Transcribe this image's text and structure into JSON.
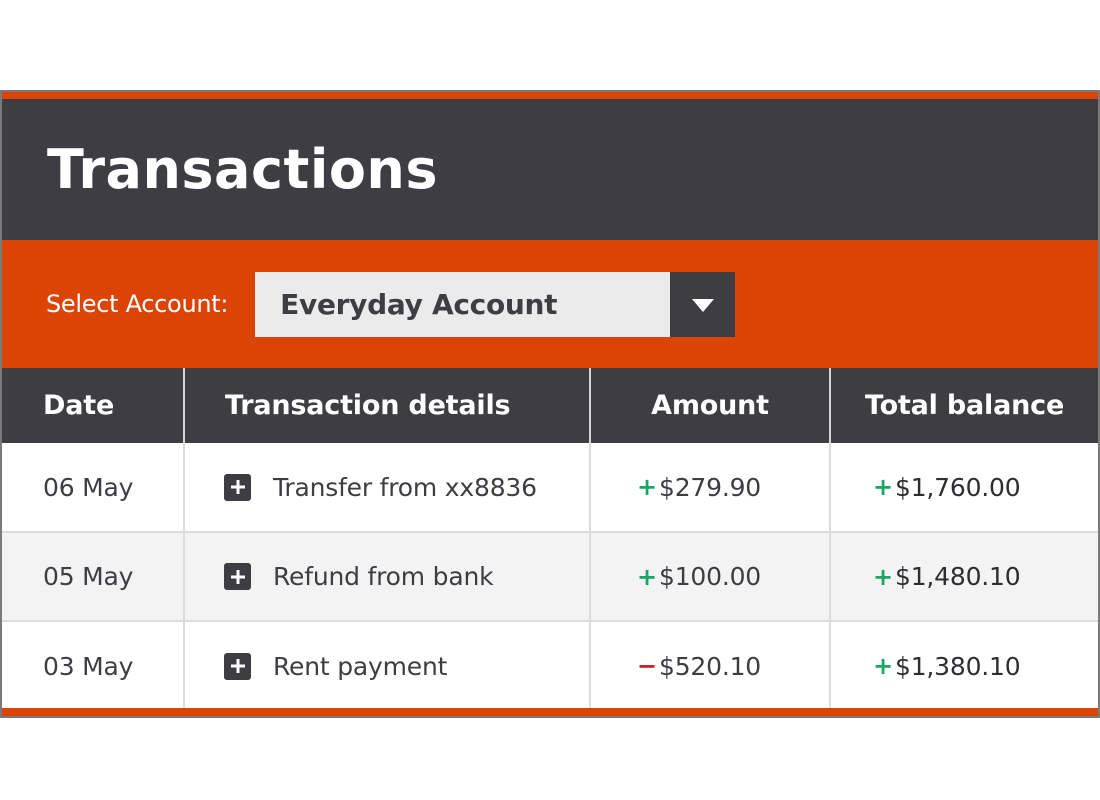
{
  "header": {
    "title": "Transactions"
  },
  "account_selector": {
    "label": "Select Account:",
    "selected": "Everyday Account",
    "arrow_icon": "caret-down-icon"
  },
  "table": {
    "columns": [
      "Date",
      "Transaction details",
      "Amount",
      "Total balance"
    ],
    "rows": [
      {
        "date": "06 May",
        "details": "Transfer from xx8836",
        "expand_icon": "plus-icon",
        "amount_sign": "+",
        "amount_type": "credit",
        "amount": "$279.90",
        "balance_sign": "+",
        "balance": "$1,760.00"
      },
      {
        "date": "05 May",
        "details": "Refund from bank",
        "expand_icon": "plus-icon",
        "amount_sign": "+",
        "amount_type": "credit",
        "amount": "$100.00",
        "balance_sign": "+",
        "balance": "$1,480.10"
      },
      {
        "date": "03 May",
        "details": "Rent payment",
        "expand_icon": "plus-icon",
        "amount_sign": "−",
        "amount_type": "debit",
        "amount": "$520.10",
        "balance_sign": "+",
        "balance": "$1,380.10"
      }
    ]
  },
  "colors": {
    "accent_orange": "#db4405",
    "dark": "#3e3d42",
    "credit_green": "#1ba566",
    "debit_red": "#cc2127",
    "select_bg": "#ebebeb",
    "alt_row": "#f3f3f3"
  }
}
